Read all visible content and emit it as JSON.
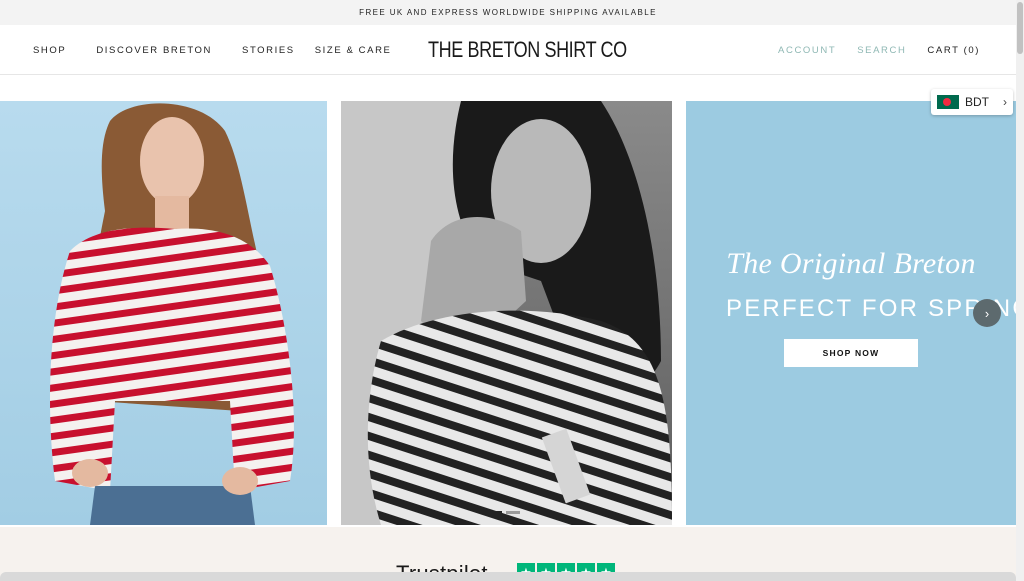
{
  "announcement": "FREE UK AND EXPRESS WORLDWIDE SHIPPING AVAILABLE",
  "nav": {
    "left": [
      "SHOP",
      "DISCOVER BRETON",
      "STORIES",
      "SIZE & CARE"
    ],
    "account": "ACCOUNT",
    "search": "SEARCH",
    "cart": "CART (0)"
  },
  "logo": "THE BRETON SHIRT CO",
  "currency": {
    "code": "BDT",
    "flag_icon": "bangladesh-flag-icon"
  },
  "hero": {
    "title": "The Original Breton",
    "subtitle": "PERFECT FOR SPRING",
    "cta": "SHOP NOW",
    "next_icon": "chevron-right-icon",
    "slides": 2,
    "active_slide": 1
  },
  "trustpilot": {
    "label": "Trustpilot",
    "stars": 5,
    "star_color": "#00b67a"
  },
  "colors": {
    "accent_muted": "#8fb8b4",
    "panel_blue": "#9ccbe1",
    "stripe_red": "#c8102e"
  }
}
